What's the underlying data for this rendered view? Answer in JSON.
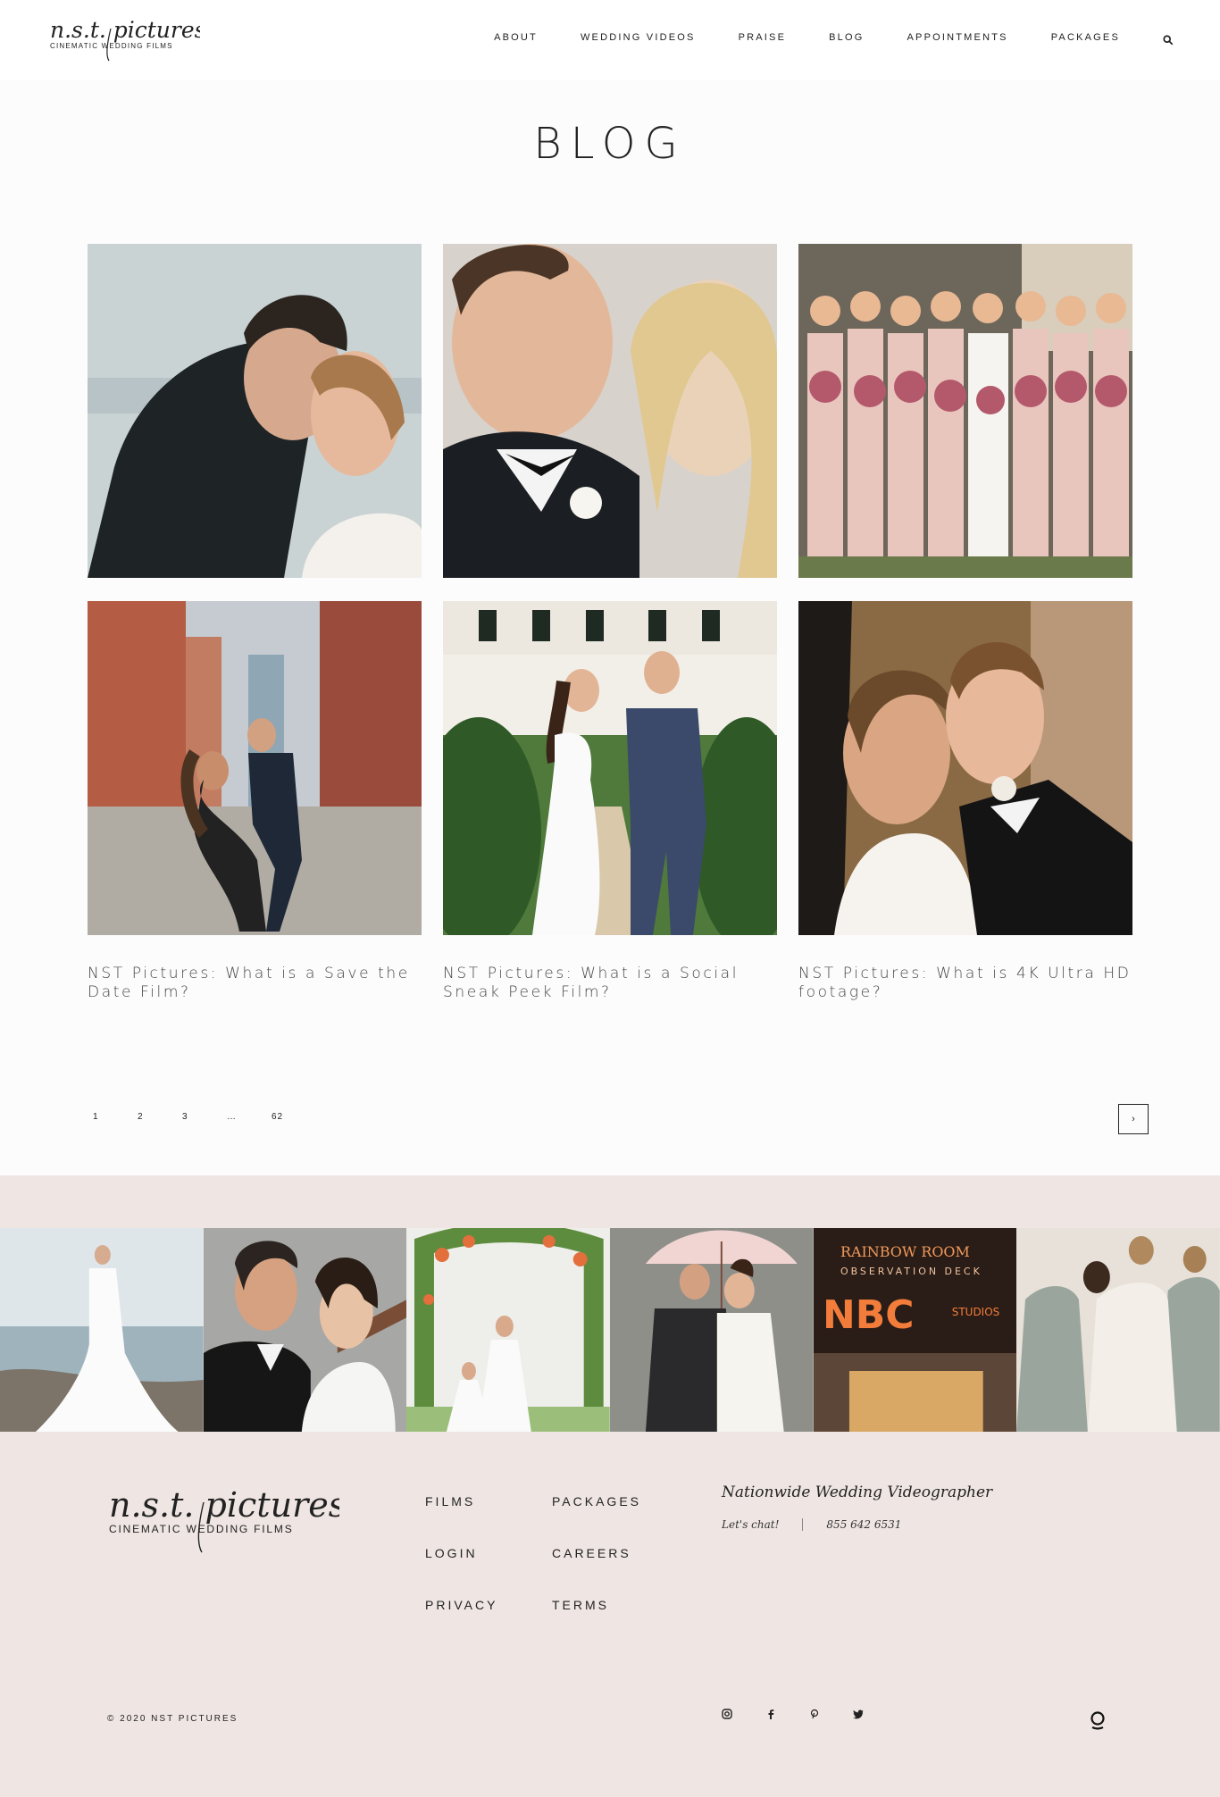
{
  "header": {
    "logo": {
      "script": "n.s.t. pictures",
      "sub": "CINEMATIC WEDDING FILMS"
    },
    "nav": [
      "ABOUT",
      "WEDDING VIDEOS",
      "PRAISE",
      "BLOG",
      "APPOINTMENTS",
      "PACKAGES"
    ],
    "search_icon": "search-icon"
  },
  "page": {
    "title": "BLOG"
  },
  "posts": [
    {
      "image": "couple-forehead-touch"
    },
    {
      "image": "groom-bride-closeup"
    },
    {
      "image": "bridesmaids-bouquets"
    },
    {
      "image": "city-street-dip",
      "title": "NST Pictures: What is a Save the Date Film?"
    },
    {
      "image": "couple-walking-lawn",
      "title": "NST Pictures: What is a Social Sneak Peek Film?"
    },
    {
      "image": "couple-cheek-kiss",
      "title": "NST Pictures: What is 4K Ultra HD footage?"
    }
  ],
  "pagination": {
    "pages": [
      "1",
      "2",
      "3",
      "…",
      "62"
    ],
    "next": "›"
  },
  "instagram": [
    "bride-by-water",
    "couple-at-railing",
    "floral-arch",
    "umbrella-kiss",
    "nbc-rainbow-room",
    "bridesmaids-dresses"
  ],
  "instagram_sign": {
    "line1": "RAINBOW ROOM",
    "line2": "OBSERVATION DECK",
    "line3": "NBC",
    "line4": "STUDIOS"
  },
  "footer": {
    "logo": {
      "script": "n.s.t. pictures",
      "sub": "CINEMATIC WEDDING FILMS"
    },
    "links": [
      "FILMS",
      "PACKAGES",
      "LOGIN",
      "CAREERS",
      "PRIVACY",
      "TERMS"
    ],
    "tagline": "Nationwide Wedding Videographer",
    "chat_label": "Let's chat!",
    "phone": "855 642 6531",
    "copyright": "© 2020 NST PICTURES",
    "socials": [
      "instagram-icon",
      "facebook-icon",
      "pinterest-icon",
      "twitter-icon"
    ]
  }
}
